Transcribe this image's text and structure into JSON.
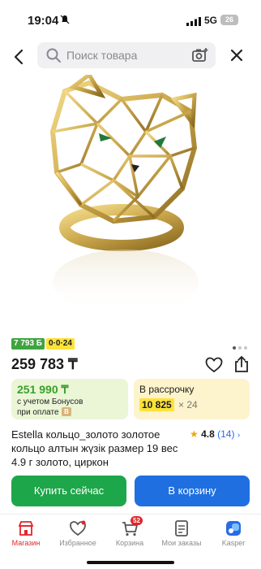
{
  "status_bar": {
    "time": "19:04",
    "network": "5G",
    "battery": "26"
  },
  "header": {
    "search_placeholder": "Поиск товара"
  },
  "product": {
    "bonus_badge": "7 793 Б",
    "installment_badge": "0·0·24",
    "price": "259 783 ₸",
    "bonus_price": "251 990 ₸",
    "bonus_line1": "с учетом Бонусов",
    "bonus_line2": "при оплате",
    "installment_title": "В рассрочку",
    "installment_amount": "10 825",
    "installment_months": "× 24",
    "title": "Estella кольцо_золото золотое кольцо алтын жүзік размер 19 вес 4.9 г золото, циркон",
    "rating": "4.8",
    "reviews": "(14)"
  },
  "actions": {
    "buy_now": "Купить сейчас",
    "add_to_cart": "В корзину"
  },
  "tabbar": {
    "items": [
      {
        "label": "Магазин"
      },
      {
        "label": "Избранное"
      },
      {
        "label": "Корзина",
        "badge": "52"
      },
      {
        "label": "Мои заказы"
      },
      {
        "label": "Kasper"
      }
    ]
  },
  "colors": {
    "accent_red": "#e5242a",
    "buy_green": "#1ea64a",
    "cart_blue": "#1f6fe0",
    "star": "#f0a800"
  }
}
